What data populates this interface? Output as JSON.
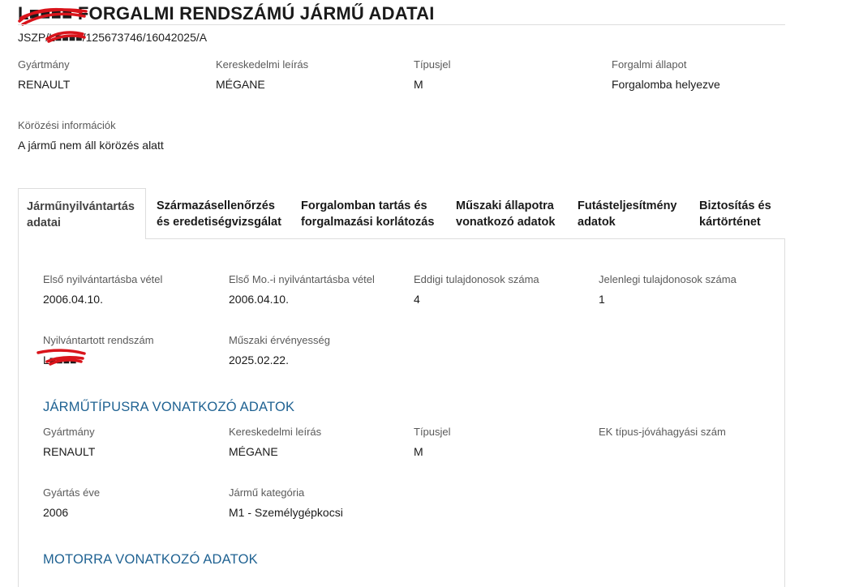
{
  "header": {
    "title": "L■■■■ FORGALMI RENDSZÁMÚ JÁRMŰ ADATAI",
    "subtitle": "JSZP/L■■■■/125673746/16042025/A"
  },
  "summary": {
    "make_label": "Gyártmány",
    "make_value": "RENAULT",
    "trade_label": "Kereskedelmi leírás",
    "trade_value": "MÉGANE",
    "type_label": "Típusjel",
    "type_value": "M",
    "status_label": "Forgalmi állapot",
    "status_value": "Forgalomba helyezve",
    "wanted_label": "Körözési információk",
    "wanted_value": "A jármű nem áll körözés alatt"
  },
  "tabs": [
    {
      "label": "Járműnyilvántartás adatai",
      "active": true
    },
    {
      "label": "Származásellenőrzés és eredetiségvizsgálat",
      "active": false
    },
    {
      "label": "Forgalomban tartás és forgalmazási korlátozás",
      "active": false
    },
    {
      "label": "Műszaki állapotra vonatkozó adatok",
      "active": false
    },
    {
      "label": "Futásteljesítmény adatok",
      "active": false
    },
    {
      "label": "Biztosítás és kártörténet",
      "active": false
    }
  ],
  "registry": {
    "first_reg_label": "Első nyilvántartásba vétel",
    "first_reg_value": "2006.04.10.",
    "first_hu_label": "Első Mo.-i nyilvántartásba vétel",
    "first_hu_value": "2006.04.10.",
    "prev_owners_label": "Eddigi tulajdonosok száma",
    "prev_owners_value": "4",
    "cur_owners_label": "Jelenlegi tulajdonosok száma",
    "cur_owners_value": "1",
    "plate_label": "Nyilvántartott rendszám",
    "plate_value": "L■■■■",
    "tech_valid_label": "Műszaki érvényesség",
    "tech_valid_value": "2025.02.22."
  },
  "vehicle_type": {
    "section_title": "JÁRMŰTÍPUSRA VONATKOZÓ ADATOK",
    "make_label": "Gyártmány",
    "make_value": "RENAULT",
    "trade_label": "Kereskedelmi leírás",
    "trade_value": "MÉGANE",
    "type_label": "Típusjel",
    "type_value": "M",
    "ek_label": "EK típus-jóváhagyási szám",
    "ek_value": "",
    "year_label": "Gyártás éve",
    "year_value": "2006",
    "category_label": "Jármű kategória",
    "category_value": "M1 - Személygépkocsi"
  },
  "engine": {
    "section_title": "MOTORRA VONATKOZÓ ADATOK"
  },
  "colors": {
    "accent": "#1f6292",
    "redaction": "#d9141b",
    "border": "#dddddd"
  }
}
